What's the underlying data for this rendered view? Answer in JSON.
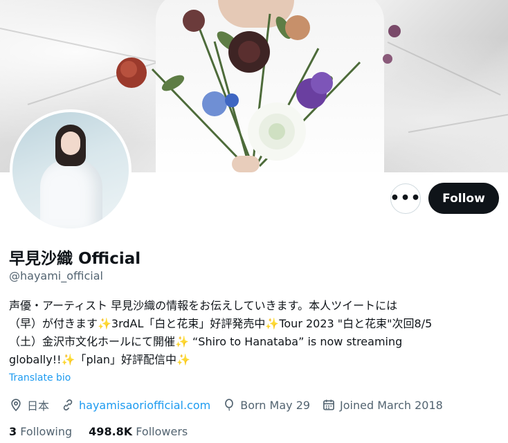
{
  "profile": {
    "display_name": "早見沙織 Official",
    "handle": "@hayami_official",
    "bio_lines": [
      "声優・アーティスト 早見沙織の情報をお伝えしていきます。本人ツイートには",
      "（早）が付きます✨3rdAL「白と花束」好評発売中✨Tour 2023 \"白と花束\"次回8/5",
      "（土）金沢市文化ホールにて開催✨ “Shiro to Hanataba” is now streaming",
      "globally!!✨「plan」好評配信中✨"
    ],
    "translate_label": "Translate bio",
    "location": "日本",
    "website": "hayamisaoriofficial.com",
    "birthday": "Born May 29",
    "joined": "Joined March 2018",
    "following_count": "3",
    "following_label": "Following",
    "followers_count": "498.8K",
    "followers_label": "Followers"
  },
  "actions": {
    "more_label": "•••",
    "follow_label": "Follow"
  },
  "icons": {
    "more": "more-horizontal-icon",
    "location": "location-pin-icon",
    "website": "link-icon",
    "birthday": "balloon-icon",
    "joined": "calendar-icon"
  },
  "colors": {
    "link": "#1d9bf0",
    "text_primary": "#0f1419",
    "text_secondary": "#536471",
    "button_dark": "#0f1419"
  }
}
